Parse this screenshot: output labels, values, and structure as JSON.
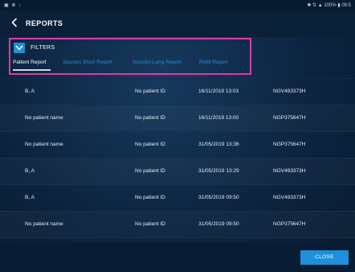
{
  "status_bar": {
    "left": "▣ ⊗ ↓",
    "right": "✱ ⇅ ▲ 100% ▮ 09:5"
  },
  "header": {
    "title": "REPORTS",
    "back_icon": "chevron-left-icon"
  },
  "filters": {
    "toggle_icon": "chevron-down-icon",
    "label": "FILTERS"
  },
  "tabs": [
    {
      "label": "Patient Report",
      "active": true
    },
    {
      "label": "Session Short Report",
      "active": false
    },
    {
      "label": "Session Long Report",
      "active": false
    },
    {
      "label": "Refill Report",
      "active": false
    }
  ],
  "rows": [
    {
      "name": "B, A",
      "patient_id": "No patient ID",
      "date": "16/11/2019 13:03",
      "serial": "NGV493373H"
    },
    {
      "name": "No patient name",
      "patient_id": "No patient ID",
      "date": "16/11/2019 13:00",
      "serial": "NGP375647H"
    },
    {
      "name": "No patient name",
      "patient_id": "No patient ID",
      "date": "31/05/2019 13:36",
      "serial": "NGP375647H"
    },
    {
      "name": "B, A",
      "patient_id": "No patient ID",
      "date": "31/05/2019 13:29",
      "serial": "NGV493373H"
    },
    {
      "name": "B, A",
      "patient_id": "No patient ID",
      "date": "31/05/2019 09:50",
      "serial": "NGV493373H"
    },
    {
      "name": "No patient name",
      "patient_id": "No patient ID",
      "date": "31/05/2019 09:50",
      "serial": "NGP375647H"
    }
  ],
  "footer": {
    "close_label": "CLOSE"
  },
  "colors": {
    "accent": "#1e8fd8",
    "highlight_border": "#d83ea6",
    "background": "#0c2440"
  }
}
